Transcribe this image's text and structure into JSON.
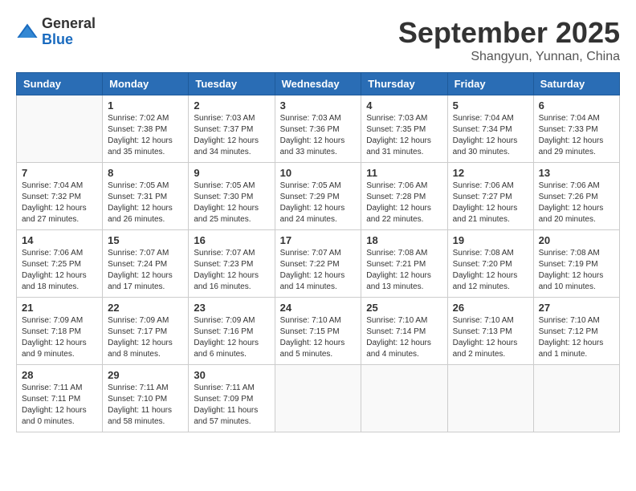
{
  "header": {
    "logo_general": "General",
    "logo_blue": "Blue",
    "month": "September 2025",
    "location": "Shangyun, Yunnan, China"
  },
  "weekdays": [
    "Sunday",
    "Monday",
    "Tuesday",
    "Wednesday",
    "Thursday",
    "Friday",
    "Saturday"
  ],
  "weeks": [
    [
      {
        "day": "",
        "info": ""
      },
      {
        "day": "1",
        "info": "Sunrise: 7:02 AM\nSunset: 7:38 PM\nDaylight: 12 hours\nand 35 minutes."
      },
      {
        "day": "2",
        "info": "Sunrise: 7:03 AM\nSunset: 7:37 PM\nDaylight: 12 hours\nand 34 minutes."
      },
      {
        "day": "3",
        "info": "Sunrise: 7:03 AM\nSunset: 7:36 PM\nDaylight: 12 hours\nand 33 minutes."
      },
      {
        "day": "4",
        "info": "Sunrise: 7:03 AM\nSunset: 7:35 PM\nDaylight: 12 hours\nand 31 minutes."
      },
      {
        "day": "5",
        "info": "Sunrise: 7:04 AM\nSunset: 7:34 PM\nDaylight: 12 hours\nand 30 minutes."
      },
      {
        "day": "6",
        "info": "Sunrise: 7:04 AM\nSunset: 7:33 PM\nDaylight: 12 hours\nand 29 minutes."
      }
    ],
    [
      {
        "day": "7",
        "info": "Sunrise: 7:04 AM\nSunset: 7:32 PM\nDaylight: 12 hours\nand 27 minutes."
      },
      {
        "day": "8",
        "info": "Sunrise: 7:05 AM\nSunset: 7:31 PM\nDaylight: 12 hours\nand 26 minutes."
      },
      {
        "day": "9",
        "info": "Sunrise: 7:05 AM\nSunset: 7:30 PM\nDaylight: 12 hours\nand 25 minutes."
      },
      {
        "day": "10",
        "info": "Sunrise: 7:05 AM\nSunset: 7:29 PM\nDaylight: 12 hours\nand 24 minutes."
      },
      {
        "day": "11",
        "info": "Sunrise: 7:06 AM\nSunset: 7:28 PM\nDaylight: 12 hours\nand 22 minutes."
      },
      {
        "day": "12",
        "info": "Sunrise: 7:06 AM\nSunset: 7:27 PM\nDaylight: 12 hours\nand 21 minutes."
      },
      {
        "day": "13",
        "info": "Sunrise: 7:06 AM\nSunset: 7:26 PM\nDaylight: 12 hours\nand 20 minutes."
      }
    ],
    [
      {
        "day": "14",
        "info": "Sunrise: 7:06 AM\nSunset: 7:25 PM\nDaylight: 12 hours\nand 18 minutes."
      },
      {
        "day": "15",
        "info": "Sunrise: 7:07 AM\nSunset: 7:24 PM\nDaylight: 12 hours\nand 17 minutes."
      },
      {
        "day": "16",
        "info": "Sunrise: 7:07 AM\nSunset: 7:23 PM\nDaylight: 12 hours\nand 16 minutes."
      },
      {
        "day": "17",
        "info": "Sunrise: 7:07 AM\nSunset: 7:22 PM\nDaylight: 12 hours\nand 14 minutes."
      },
      {
        "day": "18",
        "info": "Sunrise: 7:08 AM\nSunset: 7:21 PM\nDaylight: 12 hours\nand 13 minutes."
      },
      {
        "day": "19",
        "info": "Sunrise: 7:08 AM\nSunset: 7:20 PM\nDaylight: 12 hours\nand 12 minutes."
      },
      {
        "day": "20",
        "info": "Sunrise: 7:08 AM\nSunset: 7:19 PM\nDaylight: 12 hours\nand 10 minutes."
      }
    ],
    [
      {
        "day": "21",
        "info": "Sunrise: 7:09 AM\nSunset: 7:18 PM\nDaylight: 12 hours\nand 9 minutes."
      },
      {
        "day": "22",
        "info": "Sunrise: 7:09 AM\nSunset: 7:17 PM\nDaylight: 12 hours\nand 8 minutes."
      },
      {
        "day": "23",
        "info": "Sunrise: 7:09 AM\nSunset: 7:16 PM\nDaylight: 12 hours\nand 6 minutes."
      },
      {
        "day": "24",
        "info": "Sunrise: 7:10 AM\nSunset: 7:15 PM\nDaylight: 12 hours\nand 5 minutes."
      },
      {
        "day": "25",
        "info": "Sunrise: 7:10 AM\nSunset: 7:14 PM\nDaylight: 12 hours\nand 4 minutes."
      },
      {
        "day": "26",
        "info": "Sunrise: 7:10 AM\nSunset: 7:13 PM\nDaylight: 12 hours\nand 2 minutes."
      },
      {
        "day": "27",
        "info": "Sunrise: 7:10 AM\nSunset: 7:12 PM\nDaylight: 12 hours\nand 1 minute."
      }
    ],
    [
      {
        "day": "28",
        "info": "Sunrise: 7:11 AM\nSunset: 7:11 PM\nDaylight: 12 hours\nand 0 minutes."
      },
      {
        "day": "29",
        "info": "Sunrise: 7:11 AM\nSunset: 7:10 PM\nDaylight: 11 hours\nand 58 minutes."
      },
      {
        "day": "30",
        "info": "Sunrise: 7:11 AM\nSunset: 7:09 PM\nDaylight: 11 hours\nand 57 minutes."
      },
      {
        "day": "",
        "info": ""
      },
      {
        "day": "",
        "info": ""
      },
      {
        "day": "",
        "info": ""
      },
      {
        "day": "",
        "info": ""
      }
    ]
  ]
}
